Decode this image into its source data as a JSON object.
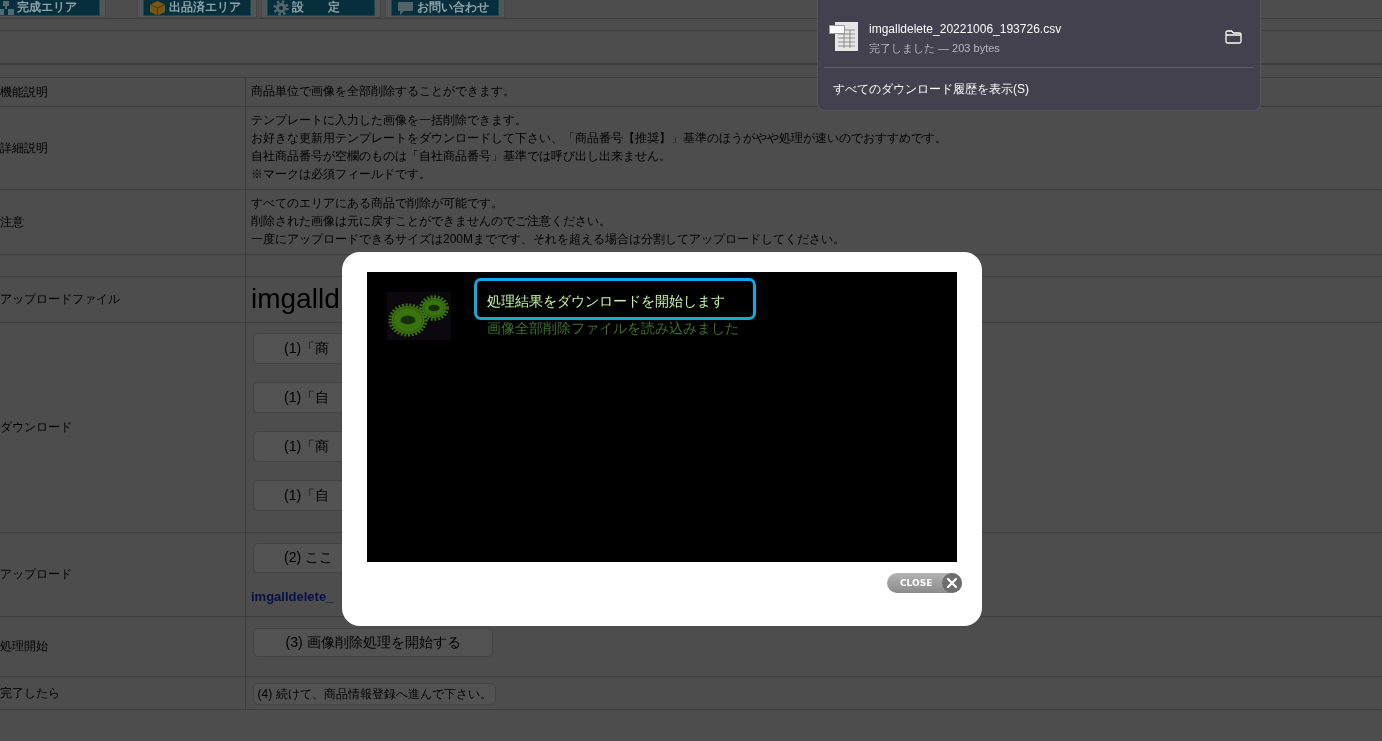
{
  "nav_buttons": [
    {
      "label": "完成エリア"
    },
    {
      "label": "出品済エリア"
    },
    {
      "label": "設　　定"
    },
    {
      "label": "お問い合わせ"
    }
  ],
  "table": {
    "rows": [
      {
        "kind": "text",
        "label": "機能説明",
        "lines": [
          "商品単位で画像を全部削除することができます。"
        ]
      },
      {
        "kind": "text",
        "label": "詳細説明",
        "lines": [
          "テンプレートに入力した画像を一括削除できます。",
          "お好きな更新用テンプレートをダウンロードして下さい、「商品番号【推奨】」基準のほうがやや処理が速いのでおすすめです。",
          "自社商品番号が空欄のものは「自社商品番号」基準では呼び出し出来ません。",
          "※マークは必須フィールドです。"
        ]
      },
      {
        "kind": "text",
        "label": "注意",
        "lines": [
          "すべてのエリアにある商品で削除が可能です。",
          "削除された画像は元に戻すことができませんのでご注意ください。",
          "一度にアップロードできるサイズは200Mまでです、それを超える場合は分割してアップロードしてください。"
        ]
      },
      {
        "kind": "spacer"
      },
      {
        "kind": "file",
        "label": "アップロードファイル",
        "value": "imgalld"
      },
      {
        "kind": "downloads",
        "label": "ダウンロード",
        "buttons": [
          "(1)「商",
          "(1)「自",
          "(1)「商",
          "(1)「自"
        ]
      },
      {
        "kind": "upload",
        "label": "アップロード",
        "button": "(2) ここ",
        "file_link": "imgalldelete_"
      },
      {
        "kind": "action",
        "label": "処理開始",
        "button": "(3) 画像削除処理を開始する"
      },
      {
        "kind": "next",
        "label": "完了したら",
        "button": "(4) 続けて、商品情報登録へ進んで下さい。"
      }
    ]
  },
  "dialog": {
    "messages": [
      {
        "text": "処理結果をダウンロードを開始します",
        "current": true
      },
      {
        "text": "画像全部削除ファイルを読み込みました",
        "current": false
      }
    ],
    "close": "CLOSE"
  },
  "downloads_panel": {
    "items": [
      {
        "file_name": "imgalldelete_20221006_193726.csv",
        "status": "完了しました — 203 bytes"
      }
    ],
    "show_all": "すべてのダウンロード履歴を表示(S)"
  }
}
